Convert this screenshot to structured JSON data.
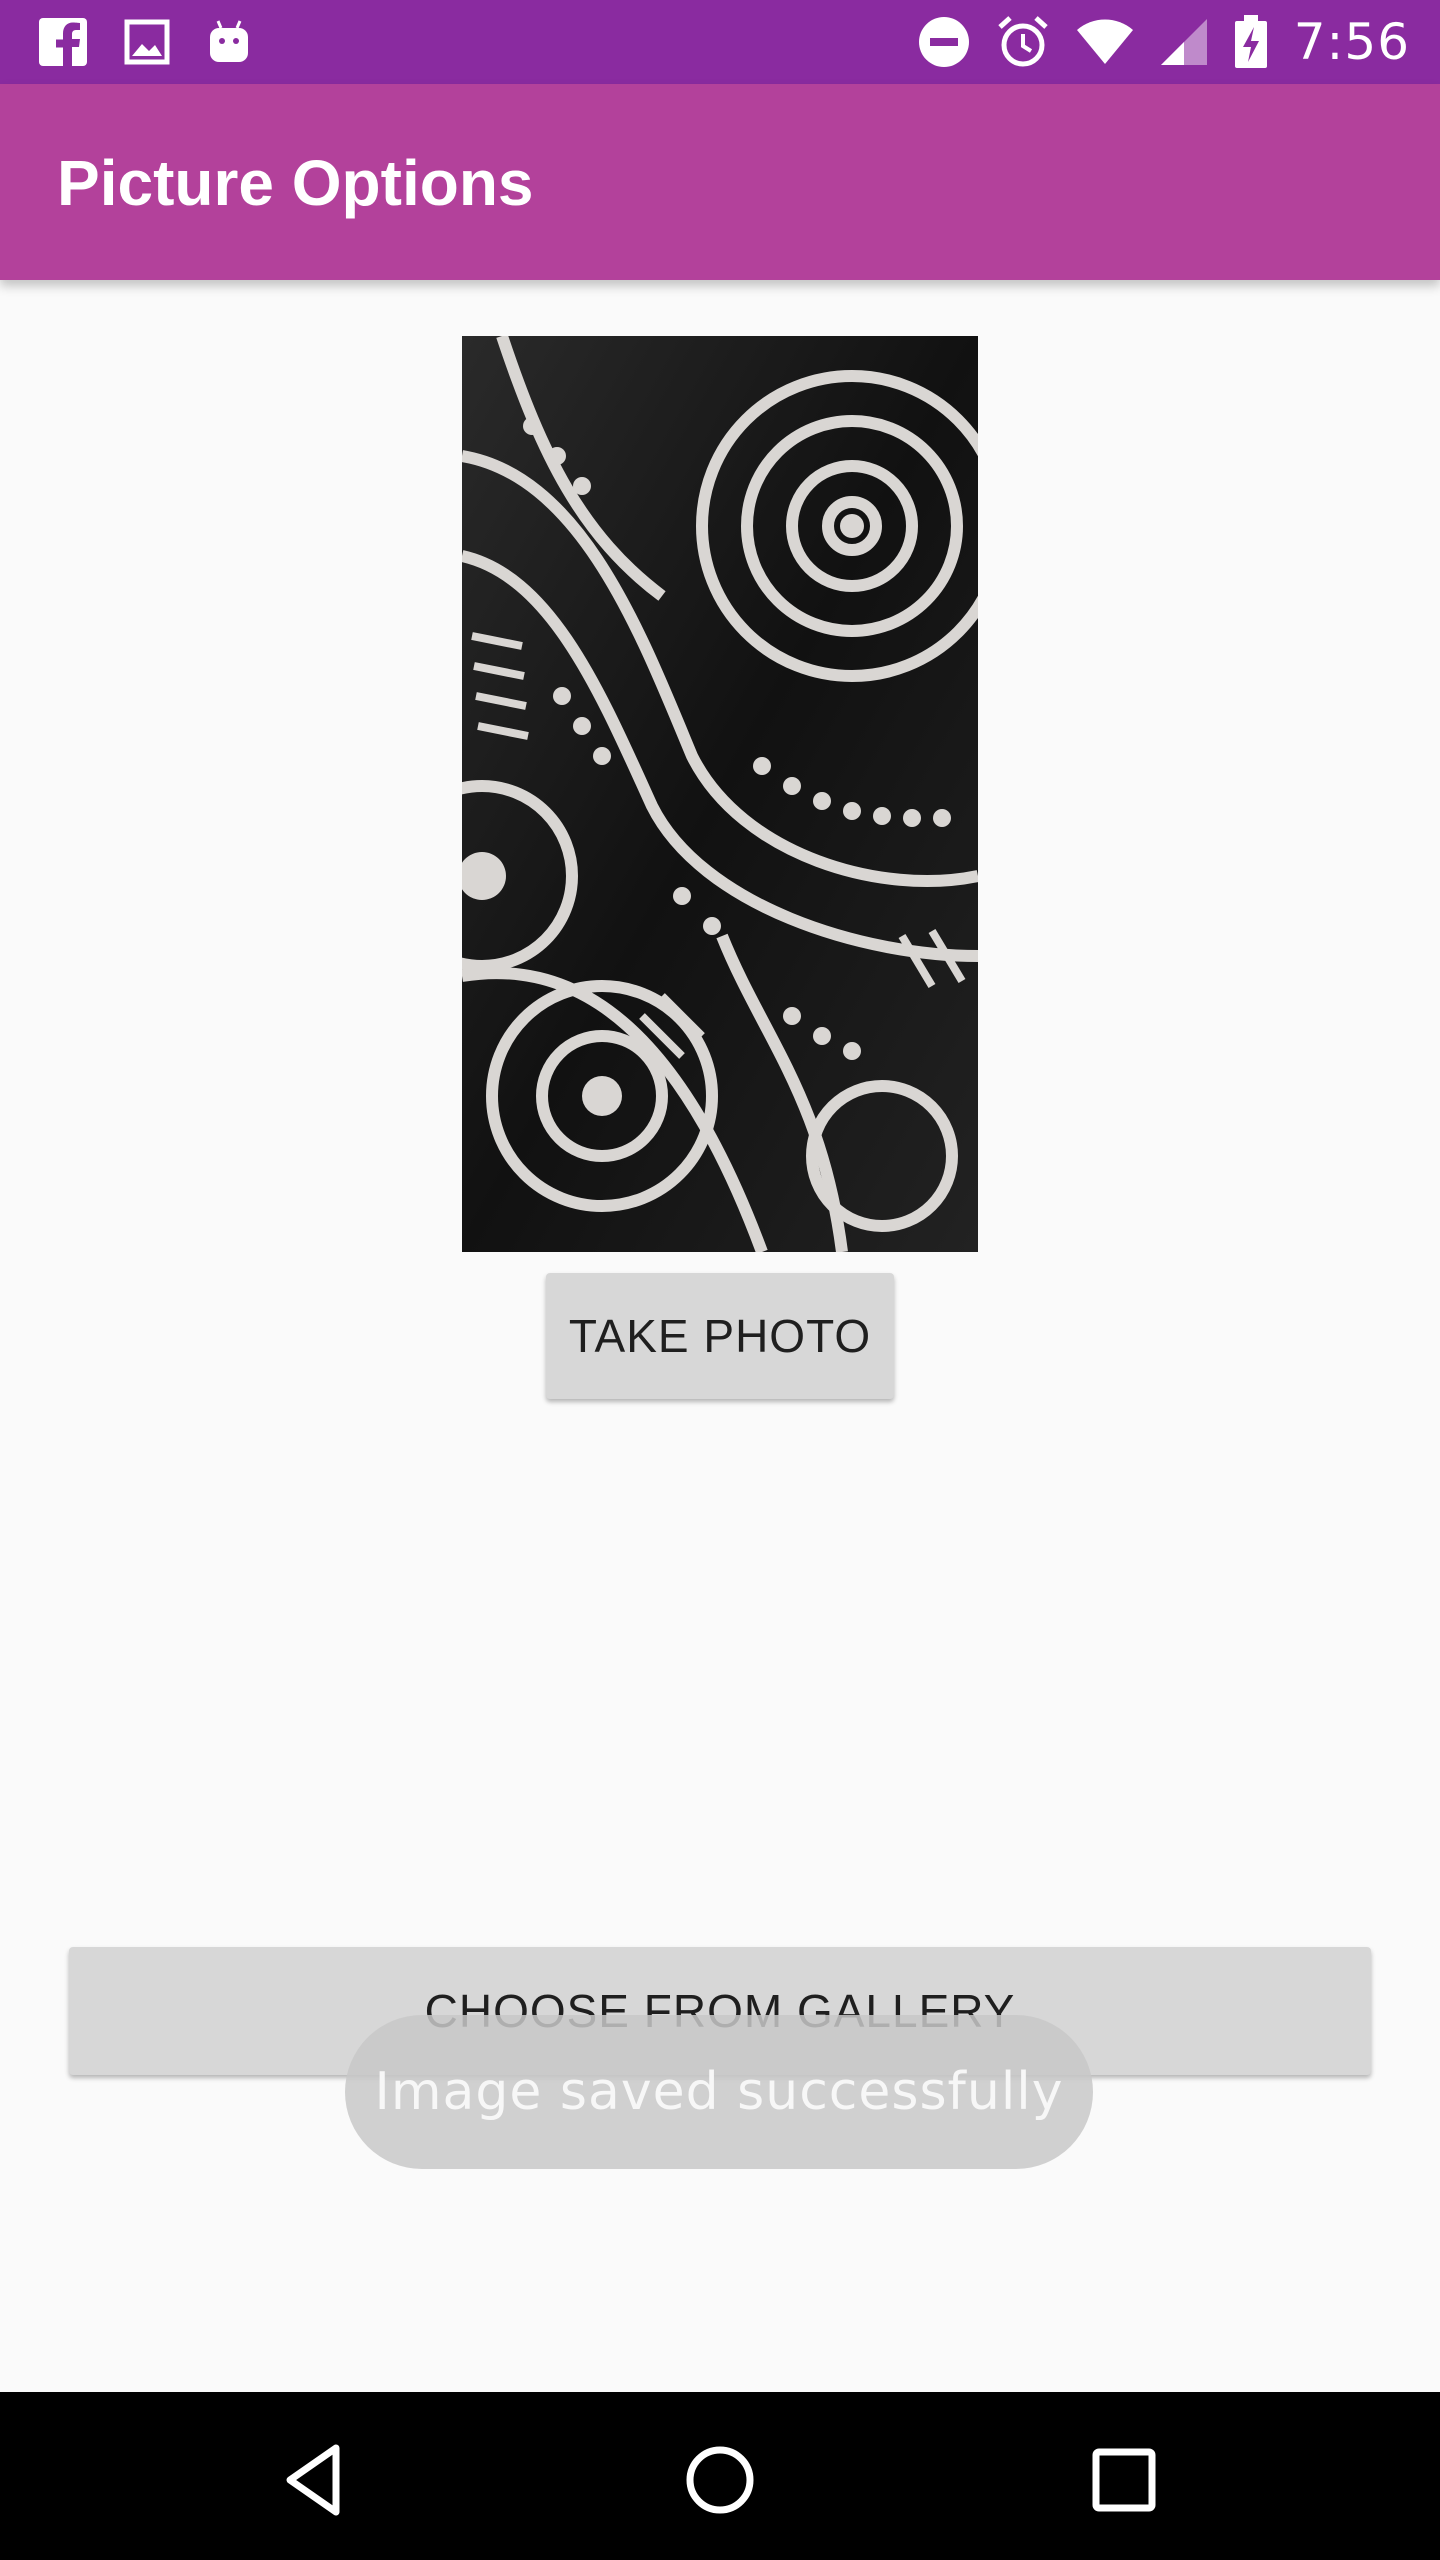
{
  "status_bar": {
    "time": "7:56",
    "left_icons": [
      "facebook-icon",
      "gallery-icon",
      "android-icon"
    ],
    "right_icons": [
      "do-not-disturb-icon",
      "alarm-icon",
      "wifi-icon",
      "cell-signal-icon",
      "battery-charging-icon"
    ]
  },
  "app_bar": {
    "title": "Picture Options"
  },
  "main": {
    "image": "photo-preview",
    "take_photo_label": "TAKE PHOTO",
    "choose_gallery_label": "CHOOSE FROM GALLERY"
  },
  "toast": {
    "message": "Image saved successfully"
  },
  "nav_bar": {
    "buttons": [
      "back-icon",
      "home-icon",
      "recents-icon"
    ]
  },
  "colors": {
    "status_bar": "#8a2ba0",
    "app_bar": "#b3419b",
    "background": "#fafafa",
    "button": "#d7d7d7"
  }
}
